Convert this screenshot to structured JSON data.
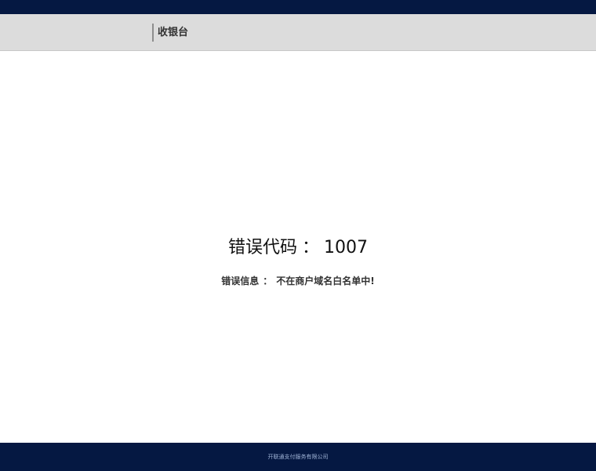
{
  "header": {
    "title": "收银台"
  },
  "error": {
    "code_label": "错误代码",
    "separator": "：",
    "code_value": "1007",
    "info_label": "错误信息",
    "info_value": "不在商户域名白名单中!"
  },
  "footer": {
    "company": "开联通支付服务有限公司"
  },
  "colors": {
    "top_bar": "#051842",
    "header_bg": "#dcdcdc",
    "footer_bg": "#051842",
    "footer_text": "#9fb3d6"
  }
}
